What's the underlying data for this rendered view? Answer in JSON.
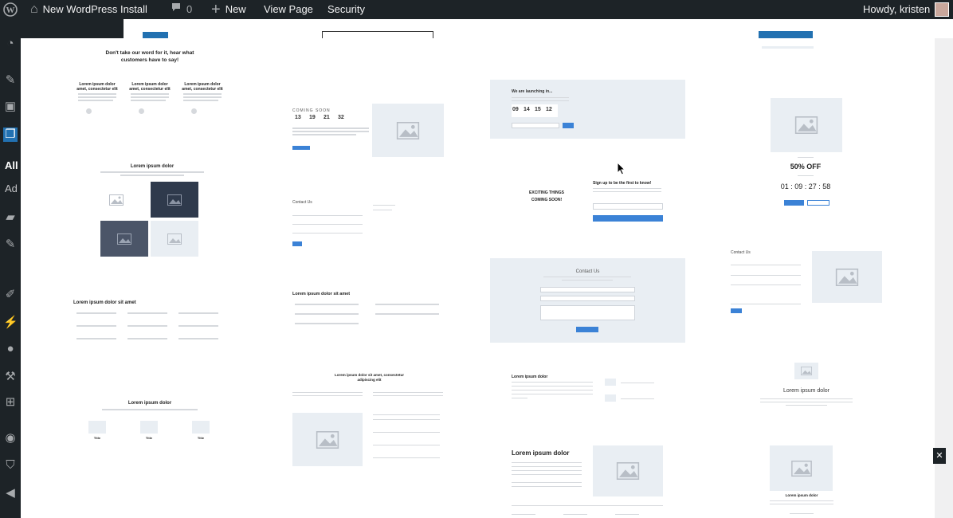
{
  "adminbar": {
    "site_name": "New WordPress Install",
    "comments_count": "0",
    "new_label": "New",
    "view_page_label": "View Page",
    "security_label": "Security",
    "howdy": "Howdy, kristen"
  },
  "sidebar": {
    "visible_text_1": "All",
    "visible_text_2": "Ad"
  },
  "patterns": {
    "testimonials_heading": "Don't take our word for it, hear what customers have to say!",
    "testimonial_title": "Lorem ipsum dolor amet, consectetur elit",
    "gallery_heading": "Lorem ipsum dolor",
    "features_heading": "Lorem ipsum dolor sit amet",
    "three_col_heading": "Lorem ipsum dolor",
    "col_title": "Title",
    "coming_soon_label": "COMING SOON",
    "coming_soon_numbers": [
      "13",
      "19",
      "21",
      "32"
    ],
    "contact_us_small": "Contact Us",
    "list_heading": "Lorem ipsum dolor sit amet",
    "split_heading": "Lorem ipsum dolor sit amet, consectetur adipiscing elit",
    "launching_heading": "We are launching in...",
    "launching_numbers": [
      "09",
      "14",
      "15",
      "12"
    ],
    "exciting_text": "EXCITING THINGS COMING SOON!",
    "signup_heading": "Sign up to be the first to know!",
    "contact_us_center": "Contact Us",
    "lorem_small": "Lorem ipsum dolor",
    "lorem_large": "Lorem ipsum dolor",
    "sale_label": "50% OFF",
    "sale_countdown": "01 : 09 : 27 : 58",
    "contact_us_right": "Contact Us",
    "lorem_right": "Lorem ipsum dolor",
    "lorem_right_small": "Lorem ipsum dolor"
  }
}
